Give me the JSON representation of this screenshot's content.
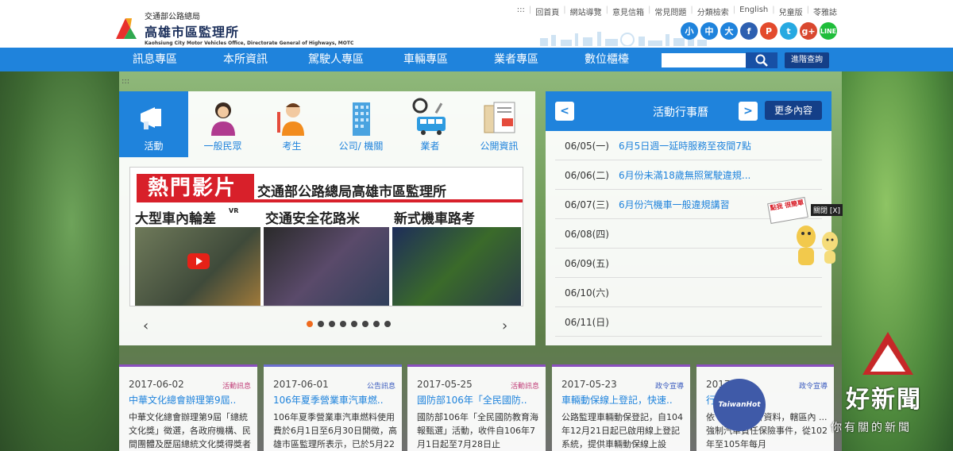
{
  "header": {
    "org_line": "交通部公路總局",
    "org_name": "高雄市區監理所",
    "org_en": "Kaohsiung City Motor Vehicles Office, Directorate General of Highways, MOTC",
    "top_links": [
      "回首頁",
      "網站導覽",
      "意見信箱",
      "常見問題",
      "分類檢索",
      "English",
      "兒童版",
      "苓雅誌"
    ],
    "access_key": ":::",
    "font_sizes": [
      "小",
      "中",
      "大"
    ],
    "social": [
      {
        "icon": "facebook-icon",
        "label": "f",
        "color": "#2d5fb0"
      },
      {
        "icon": "plurk-icon",
        "label": "P",
        "color": "#e34a2c"
      },
      {
        "icon": "twitter-icon",
        "label": "t",
        "color": "#27a9e1"
      },
      {
        "icon": "googleplus-icon",
        "label": "g+",
        "color": "#d9482f"
      },
      {
        "icon": "line-icon",
        "label": "LINE",
        "color": "#1fbd3a"
      }
    ]
  },
  "nav": {
    "items": [
      "訊息專區",
      "本所資訊",
      "駕駛人專區",
      "車輛專區",
      "業者專區",
      "數位櫃檯"
    ],
    "search_placeholder": "",
    "advanced_search": "進階查詢"
  },
  "categories": [
    {
      "label": "活動",
      "icon": "megaphone-icon"
    },
    {
      "label": "一般民眾",
      "icon": "citizen-icon"
    },
    {
      "label": "考生",
      "icon": "student-icon"
    },
    {
      "label": "公司/ 機關",
      "icon": "building-icon"
    },
    {
      "label": "業者",
      "icon": "bus-icon"
    },
    {
      "label": "公開資訊",
      "icon": "document-icon"
    }
  ],
  "video": {
    "title": "熱門影片",
    "subtitle": "交通部公路總局高雄市區監理所",
    "captions": [
      "大型車內輪差",
      "交通安全花路米",
      "新式機車路考"
    ],
    "vr_label": "VR"
  },
  "calendar": {
    "title": "活動行事曆",
    "prev": "<",
    "next": ">",
    "more": "更多內容",
    "rows": [
      {
        "date": "06/05(一)",
        "event": "6月5日週一延時服務至夜間7點"
      },
      {
        "date": "06/06(二)",
        "event": "6月份未滿18歲無照駕駛違規..."
      },
      {
        "date": "06/07(三)",
        "event": "6月份汽機車一般違規講習"
      },
      {
        "date": "06/08(四)",
        "event": ""
      },
      {
        "date": "06/09(五)",
        "event": ""
      },
      {
        "date": "06/10(六)",
        "event": ""
      },
      {
        "date": "06/11(日)",
        "event": ""
      }
    ]
  },
  "news": [
    {
      "date": "2017-06-02",
      "category": "活動訊息",
      "title": "中華文化總會辦理第9屆..",
      "body": "中華文化總會辦理第9屆「總統文化獎」徵選，各政府機構、民間團體及歷屆總統文化獎得獎者"
    },
    {
      "date": "2017-06-01",
      "category": "公告訊息",
      "title": "106年夏季營業車汽車燃..",
      "body": "106年夏季營業車汽車燃料使用費於6月1日至6月30日開徵，高雄市區監理所表示，已於5月22"
    },
    {
      "date": "2017-05-25",
      "category": "活動訊息",
      "title": "國防部106年「全民國防..",
      "body": "國防部106年「全民國防教育海報甄選」活動，收件自106年7月1日起至7月28日止"
    },
    {
      "date": "2017-05-23",
      "category": "政令宣導",
      "title": "車輛動保線上登記，快速..",
      "body": "公路監理車輛動保登記，自104年12月21日起已啟用線上登記系統，提供車輛動保線上設"
    },
    {
      "date": "2017",
      "category": "政令宣導",
      "title": "行..",
      "body": "依 ... 理所統計資料，轄區內 ... 強制汽車責任保險事件，從102年至105年每月"
    }
  ],
  "popup": {
    "close": "關閉 [X]",
    "sign": "點我 很簡單"
  },
  "watermark": {
    "logo": "TaiwanHot",
    "title": "好新聞",
    "subtitle": "你有關的新聞"
  }
}
